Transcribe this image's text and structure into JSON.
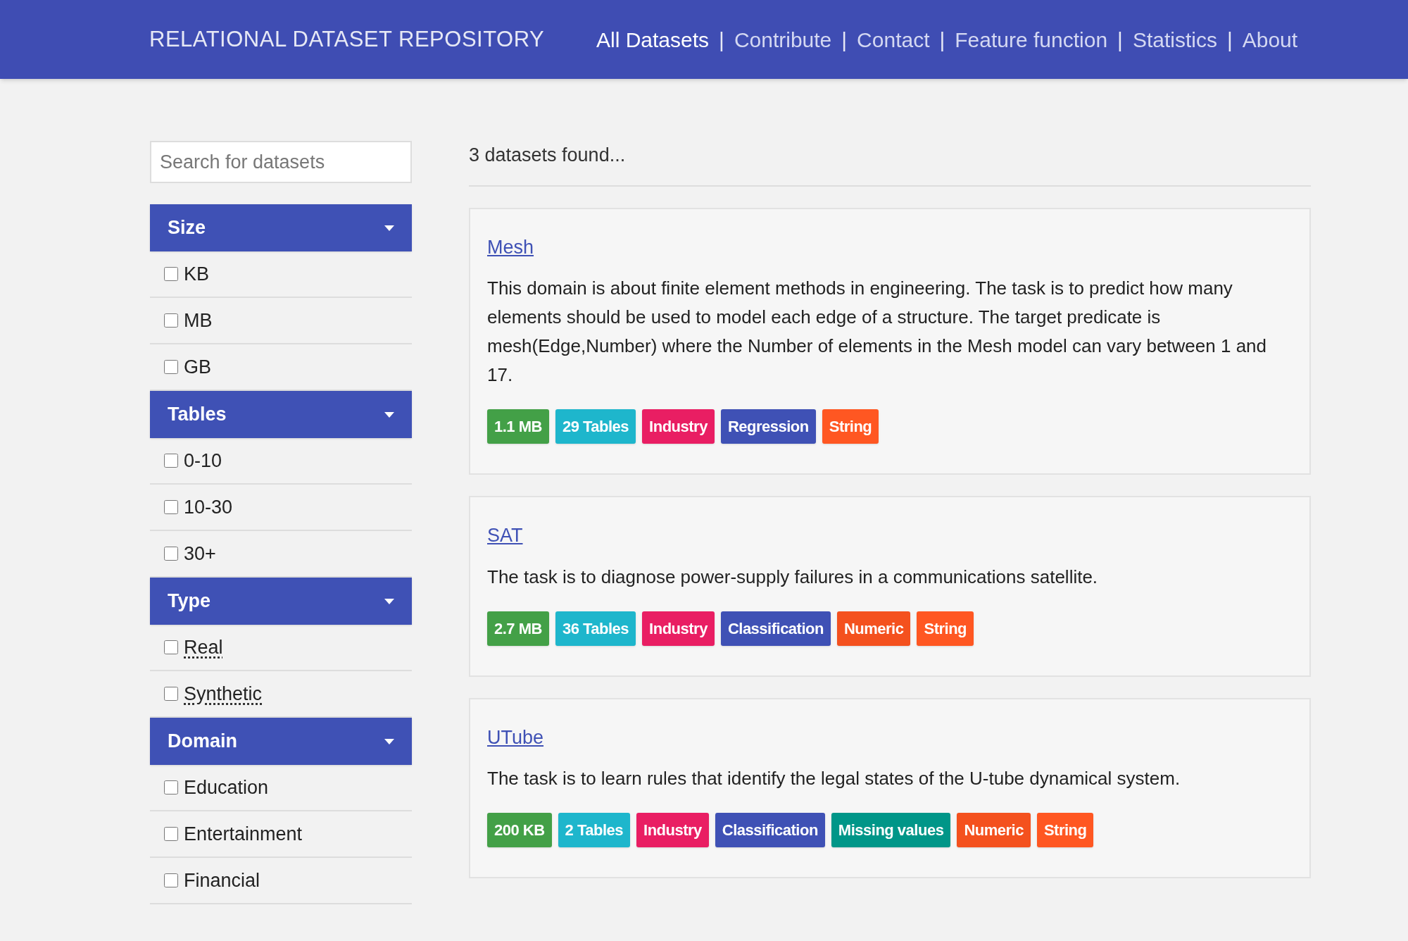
{
  "header": {
    "title": "RELATIONAL DATASET REPOSITORY",
    "nav": [
      {
        "label": "All Datasets",
        "selected": true
      },
      {
        "label": "Contribute",
        "selected": false
      },
      {
        "label": "Contact",
        "selected": false
      },
      {
        "label": "Feature function",
        "selected": false
      },
      {
        "label": "Statistics",
        "selected": false
      },
      {
        "label": "About",
        "selected": false
      }
    ],
    "separator": "|"
  },
  "search": {
    "placeholder": "Search for datasets"
  },
  "filters": [
    {
      "title": "Size",
      "expanded": true,
      "options": [
        {
          "label": "KB",
          "checked": false,
          "kind": "plain"
        },
        {
          "label": "MB",
          "checked": false,
          "kind": "plain"
        },
        {
          "label": "GB",
          "checked": false,
          "kind": "plain"
        }
      ]
    },
    {
      "title": "Tables",
      "expanded": true,
      "options": [
        {
          "label": "0-10",
          "checked": false,
          "kind": "plain"
        },
        {
          "label": "10-30",
          "checked": false,
          "kind": "plain"
        },
        {
          "label": "30+",
          "checked": false,
          "kind": "plain"
        }
      ]
    },
    {
      "title": "Type",
      "expanded": true,
      "options": [
        {
          "label": "Real",
          "checked": false,
          "kind": "abbr"
        },
        {
          "label": "Synthetic",
          "checked": false,
          "kind": "abbr"
        }
      ]
    },
    {
      "title": "Domain",
      "expanded": true,
      "options": [
        {
          "label": "Education",
          "checked": false,
          "kind": "plain"
        },
        {
          "label": "Entertainment",
          "checked": false,
          "kind": "plain"
        },
        {
          "label": "Financial",
          "checked": false,
          "kind": "plain"
        }
      ]
    }
  ],
  "results": {
    "count": "3 datasets found...",
    "datasets": [
      {
        "name": "Mesh",
        "description": "This domain is about finite element methods in engineering. The task is to predict how many elements should be used to model each edge of a structure. The target predicate is mesh(Edge,Number) where the Number of elements in the Mesh model can vary between 1 and 17.",
        "tags": [
          {
            "label": "1.1 MB",
            "color": "#43a047"
          },
          {
            "label": "29 Tables",
            "color": "#1eb6cc"
          },
          {
            "label": "Industry",
            "color": "#e91e63"
          },
          {
            "label": "Regression",
            "color": "#3f51b5"
          },
          {
            "label": "String",
            "color": "#ff5722"
          }
        ]
      },
      {
        "name": "SAT",
        "description": "The task is to diagnose power-supply failures in a communications satellite.",
        "tags": [
          {
            "label": "2.7 MB",
            "color": "#43a047"
          },
          {
            "label": "36 Tables",
            "color": "#1eb6cc"
          },
          {
            "label": "Industry",
            "color": "#e91e63"
          },
          {
            "label": "Classification",
            "color": "#3f51b5"
          },
          {
            "label": "Numeric",
            "color": "#f4511e"
          },
          {
            "label": "String",
            "color": "#ff5722"
          }
        ]
      },
      {
        "name": "UTube",
        "description": "The task is to learn rules that identify the legal states of the U-tube dynamical system.",
        "tags": [
          {
            "label": "200 KB",
            "color": "#43a047"
          },
          {
            "label": "2 Tables",
            "color": "#1eb6cc"
          },
          {
            "label": "Industry",
            "color": "#e91e63"
          },
          {
            "label": "Classification",
            "color": "#3f51b5"
          },
          {
            "label": "Missing values",
            "color": "#009688"
          },
          {
            "label": "Numeric",
            "color": "#f4511e"
          },
          {
            "label": "String",
            "color": "#ff5722"
          }
        ]
      }
    ]
  }
}
